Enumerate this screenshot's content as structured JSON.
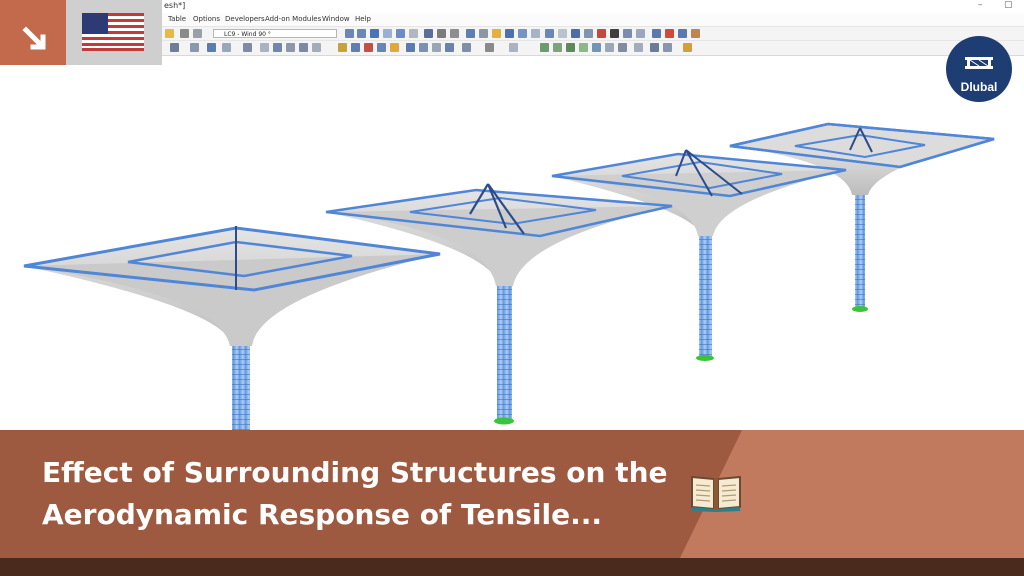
{
  "window": {
    "title_fragment": "esh*]",
    "controls": [
      "–",
      "▢"
    ]
  },
  "menubar": {
    "items": [
      "Table",
      "Options",
      "Developers",
      "Add-on Modules",
      "Window",
      "Help"
    ]
  },
  "toolbar": {
    "load_case": "LC9 - Wind 90 °"
  },
  "icons": {
    "corner": "arrow-down-right-icon",
    "flag": "us-flag-icon",
    "book": "book-icon"
  },
  "logo": {
    "text": "Dlubal",
    "color": "#1e3d73"
  },
  "banner": {
    "line1": "Effect of Surrounding Structures on the",
    "line2": "Aerodynamic Response of Tensile...",
    "color_dark": "#9d5a41",
    "color_light": "#c27a5e"
  }
}
